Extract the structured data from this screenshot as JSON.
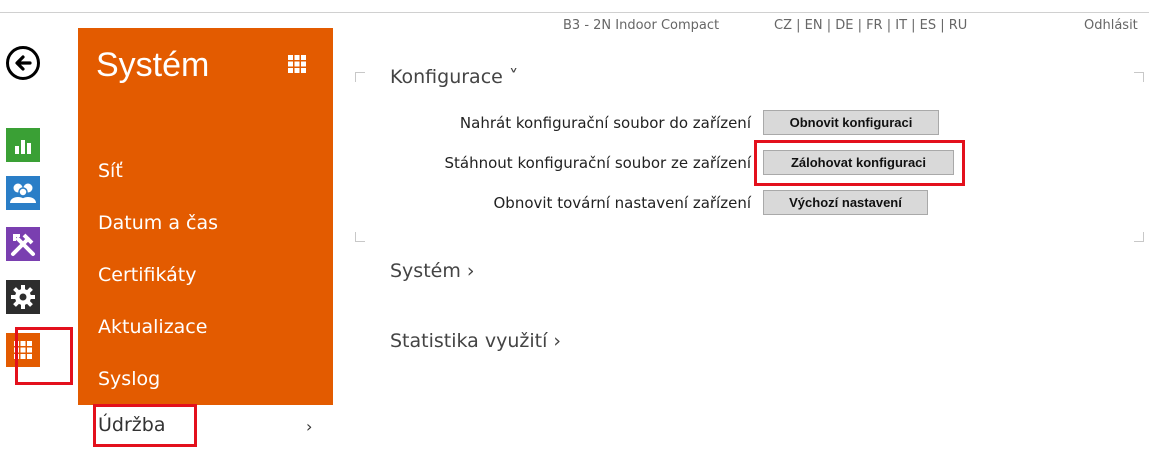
{
  "topbar": {
    "device": "B3 - 2N Indoor Compact",
    "languages": "CZ | EN | DE | FR | IT | ES | RU",
    "logout": "Odhlásit"
  },
  "icons": {
    "back": "back-arrow-icon",
    "status": "bar-chart-icon",
    "directory": "users-icon",
    "hardware": "tools-icon",
    "services": "gear-icon",
    "system": "grid-icon"
  },
  "sidebar": {
    "title": "Systém",
    "items": [
      {
        "label": "Síť"
      },
      {
        "label": "Datum a čas"
      },
      {
        "label": "Certifikáty"
      },
      {
        "label": "Aktualizace"
      },
      {
        "label": "Syslog"
      },
      {
        "label": "Údržba",
        "active": true,
        "arrow": "›"
      }
    ]
  },
  "main": {
    "sections": [
      {
        "title": "Konfigurace ˅",
        "expanded": true,
        "rows": [
          {
            "label": "Nahrát konfigurační soubor do zařízení",
            "button": "Obnovit konfiguraci"
          },
          {
            "label": "Stáhnout konfigurační soubor ze zařízení",
            "button": "Zálohovat konfiguraci"
          },
          {
            "label": "Obnovit tovární nastavení zařízení",
            "button": "Výchozí nastavení"
          }
        ]
      },
      {
        "title": "Systém ›",
        "expanded": false
      },
      {
        "title": "Statistika využití ›",
        "expanded": false
      }
    ]
  },
  "colors": {
    "panel": "#e35b00",
    "highlight": "#e3101c",
    "green": "#3aa035",
    "blue": "#2a7ec7",
    "purple": "#7a3fb0",
    "dark": "#2d2d2d"
  }
}
